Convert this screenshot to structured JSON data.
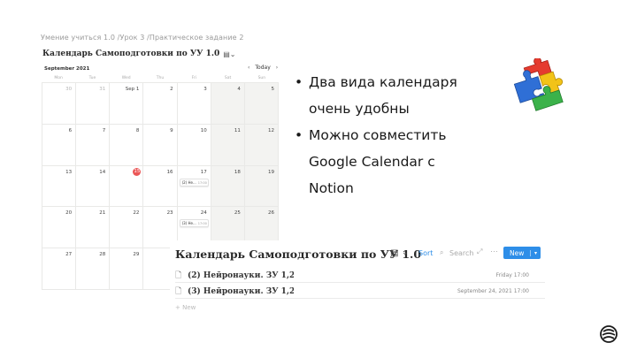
{
  "breadcrumb": "Умение учиться 1.0 /Урок 3 /Практическое задание 2",
  "calendar": {
    "title": "Календарь Самоподготовки по УУ 1.0",
    "month": "September 2021",
    "today_label": "Today",
    "weekdays": [
      "Mon",
      "Tue",
      "Wed",
      "Thu",
      "Fri",
      "Sat",
      "Sun"
    ],
    "weeks": [
      [
        "30",
        "31",
        "Sep 1",
        "2",
        "3",
        "4",
        "5"
      ],
      [
        "6",
        "7",
        "8",
        "9",
        "10",
        "11",
        "12"
      ],
      [
        "13",
        "14",
        "15",
        "16",
        "17",
        "18",
        "19"
      ],
      [
        "20",
        "21",
        "22",
        "23",
        "24",
        "25",
        "26"
      ],
      [
        "27",
        "28",
        "29",
        "",
        "",
        "",
        ""
      ]
    ],
    "today_date": "15",
    "events": [
      {
        "label": "(2) Не...",
        "time": "17:00"
      },
      {
        "label": "(3) Не...",
        "time": "17:00"
      }
    ]
  },
  "bullets": [
    "Два вида календаря очень удобны",
    "Можно совместить Google Calendar с Notion"
  ],
  "table": {
    "title": "Календарь Самоподготовки по УУ 1.0",
    "sort_label": "Sort",
    "search_label": "Search",
    "new_label": "New",
    "rows": [
      {
        "name": "(2) Нейронауки. ЗУ 1,2",
        "date": "Friday 17:00"
      },
      {
        "name": "(3) Нейронауки. ЗУ 1,2",
        "date": "September 24, 2021 17:00"
      }
    ],
    "add_label": "New"
  }
}
